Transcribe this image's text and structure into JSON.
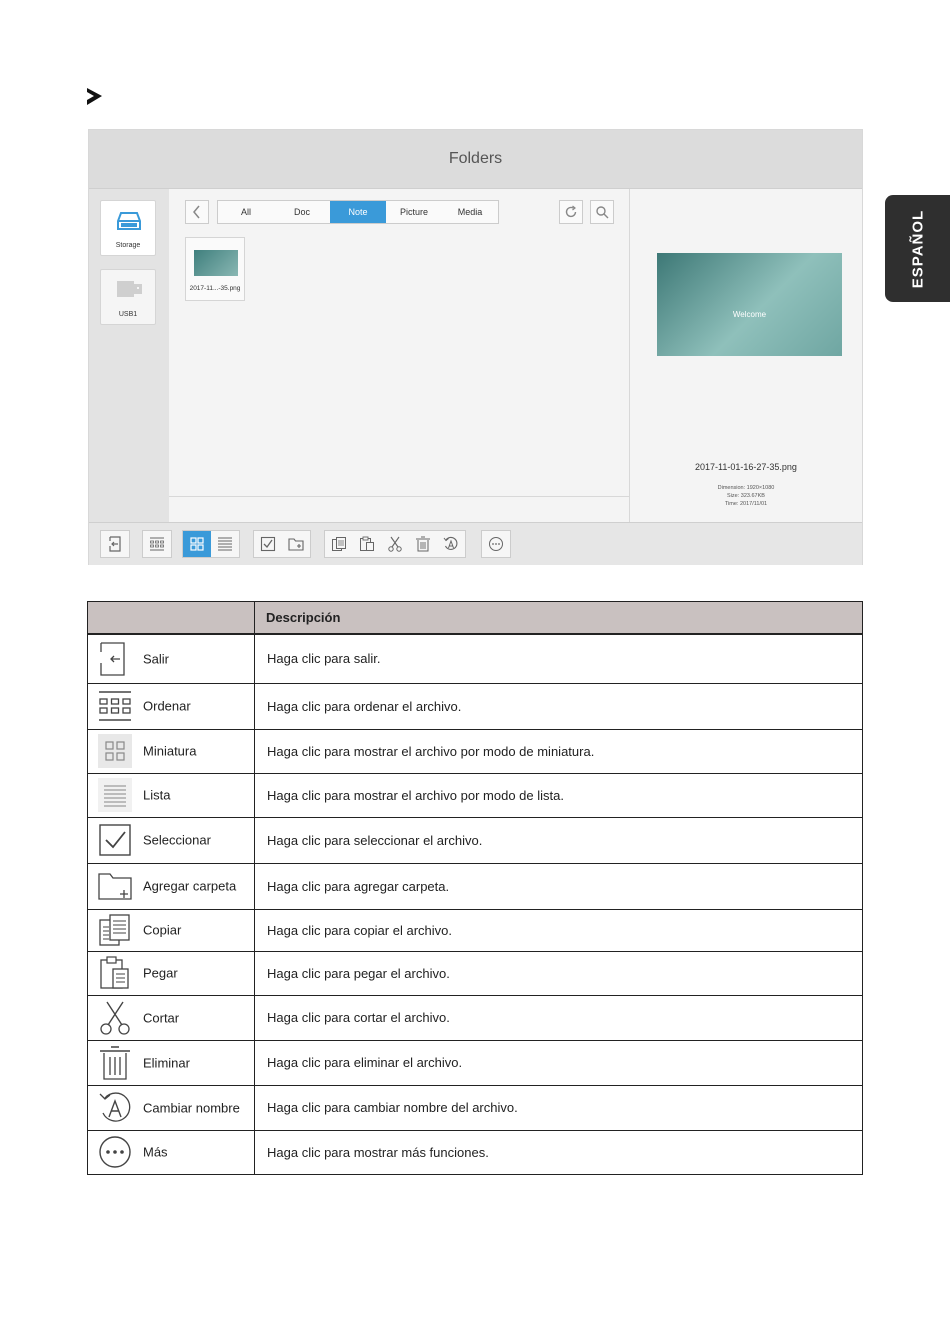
{
  "side_tab": {
    "label": "ESPAÑOL"
  },
  "app": {
    "title": "Folders",
    "storage": [
      {
        "label": "Storage",
        "icon": "storage-icon"
      },
      {
        "label": "USB1",
        "icon": "usb-icon"
      }
    ],
    "tabs": [
      "All",
      "Doc",
      "Note",
      "Picture",
      "Media"
    ],
    "active_tab": "Note",
    "file": {
      "name": "2017-11...-35.png"
    },
    "preview": {
      "welcome": "Welcome",
      "filename": "2017-11-01-16-27-35.png",
      "dimension": "Dimension: 1920×1080",
      "size": "Size: 323.67KB",
      "time": "Time: 2017/11/01"
    }
  },
  "table": {
    "header": {
      "col1": "",
      "col2": "Descripción"
    },
    "rows": [
      {
        "icon": "exit-icon",
        "name": "Salir",
        "desc": "Haga clic para salir."
      },
      {
        "icon": "sort-icon",
        "name": "Ordenar",
        "desc": "Haga clic para ordenar el archivo."
      },
      {
        "icon": "thumbnail-icon",
        "name": "Miniatura",
        "desc": "Haga clic para mostrar el archivo por modo de miniatura."
      },
      {
        "icon": "list-icon",
        "name": "Lista",
        "desc": "Haga clic para mostrar el archivo por modo de lista."
      },
      {
        "icon": "checkbox-icon",
        "name": "Seleccionar",
        "desc": "Haga clic para seleccionar el archivo."
      },
      {
        "icon": "add-folder-icon",
        "name": "Agregar carpeta",
        "desc": "Haga clic para agregar carpeta."
      },
      {
        "icon": "copy-icon",
        "name": "Copiar",
        "desc": "Haga clic para copiar el archivo."
      },
      {
        "icon": "paste-icon",
        "name": "Pegar",
        "desc": "Haga clic para pegar el archivo."
      },
      {
        "icon": "scissors-icon",
        "name": "Cortar",
        "desc": "Haga clic para cortar el archivo."
      },
      {
        "icon": "trash-icon",
        "name": "Eliminar",
        "desc": "Haga clic para eliminar el archivo."
      },
      {
        "icon": "rename-icon",
        "name": "Cambiar nombre",
        "desc": "Haga clic para cambiar nombre del archivo."
      },
      {
        "icon": "more-icon",
        "name": "Más",
        "desc": "Haga clic para mostrar más funciones."
      }
    ]
  }
}
